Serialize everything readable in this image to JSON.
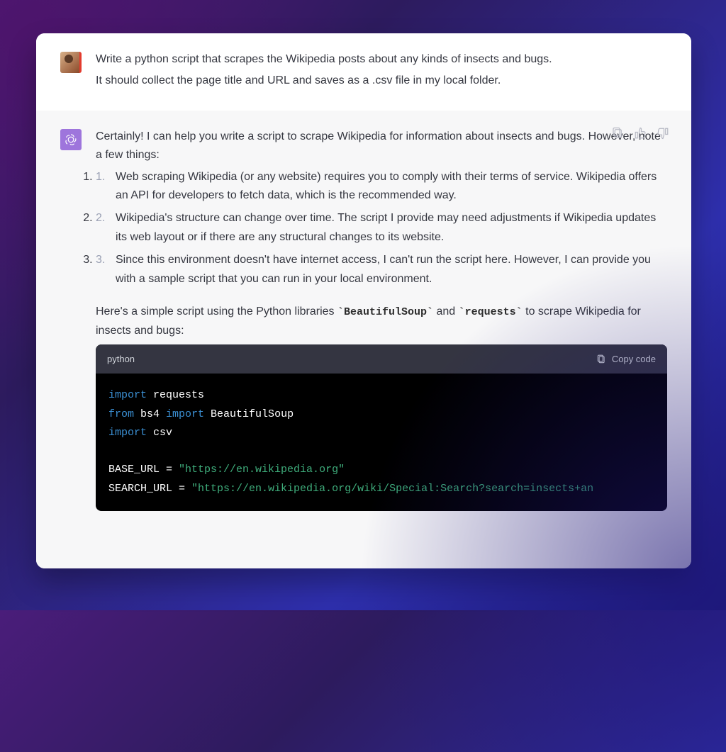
{
  "user_message": {
    "line1": "Write a python script that scrapes the Wikipedia posts about any kinds of insects and bugs.",
    "line2": "It should collect the page title and URL and saves as a .csv file in my local folder."
  },
  "assistant_message": {
    "intro": "Certainly! I can help you write a script to scrape Wikipedia for information about insects and bugs. However, note a few things:",
    "notes": [
      "Web scraping Wikipedia (or any website) requires you to comply with their terms of service. Wikipedia offers an API for developers to fetch data, which is the recommended way.",
      "Wikipedia's structure can change over time. The script I provide may need adjustments if Wikipedia updates its web layout or if there are any structural changes to its website.",
      "Since this environment doesn't have internet access, I can't run the script here. However, I can provide you with a sample script that you can run in your local environment."
    ],
    "after_notes_prefix": "Here's a simple script using the Python libraries ",
    "lib1": "BeautifulSoup",
    "and_word": " and ",
    "lib2": "requests",
    "after_notes_suffix": " to scrape Wikipedia for insects and bugs:"
  },
  "code": {
    "language": "python",
    "copy_label": "Copy code",
    "tokens": {
      "import1_kw": "import",
      "import1_mod": " requests",
      "from_kw": "from",
      "bs4": " bs4 ",
      "import2_kw": "import",
      "beautifulsoup": " BeautifulSoup",
      "import3_kw": "import",
      "csv": " csv",
      "base_lhs": "BASE_URL = ",
      "base_val": "\"https://en.wikipedia.org\"",
      "search_lhs": "SEARCH_URL = ",
      "search_val": "\"https://en.wikipedia.org/wiki/Special:Search?search=insects+an"
    }
  }
}
